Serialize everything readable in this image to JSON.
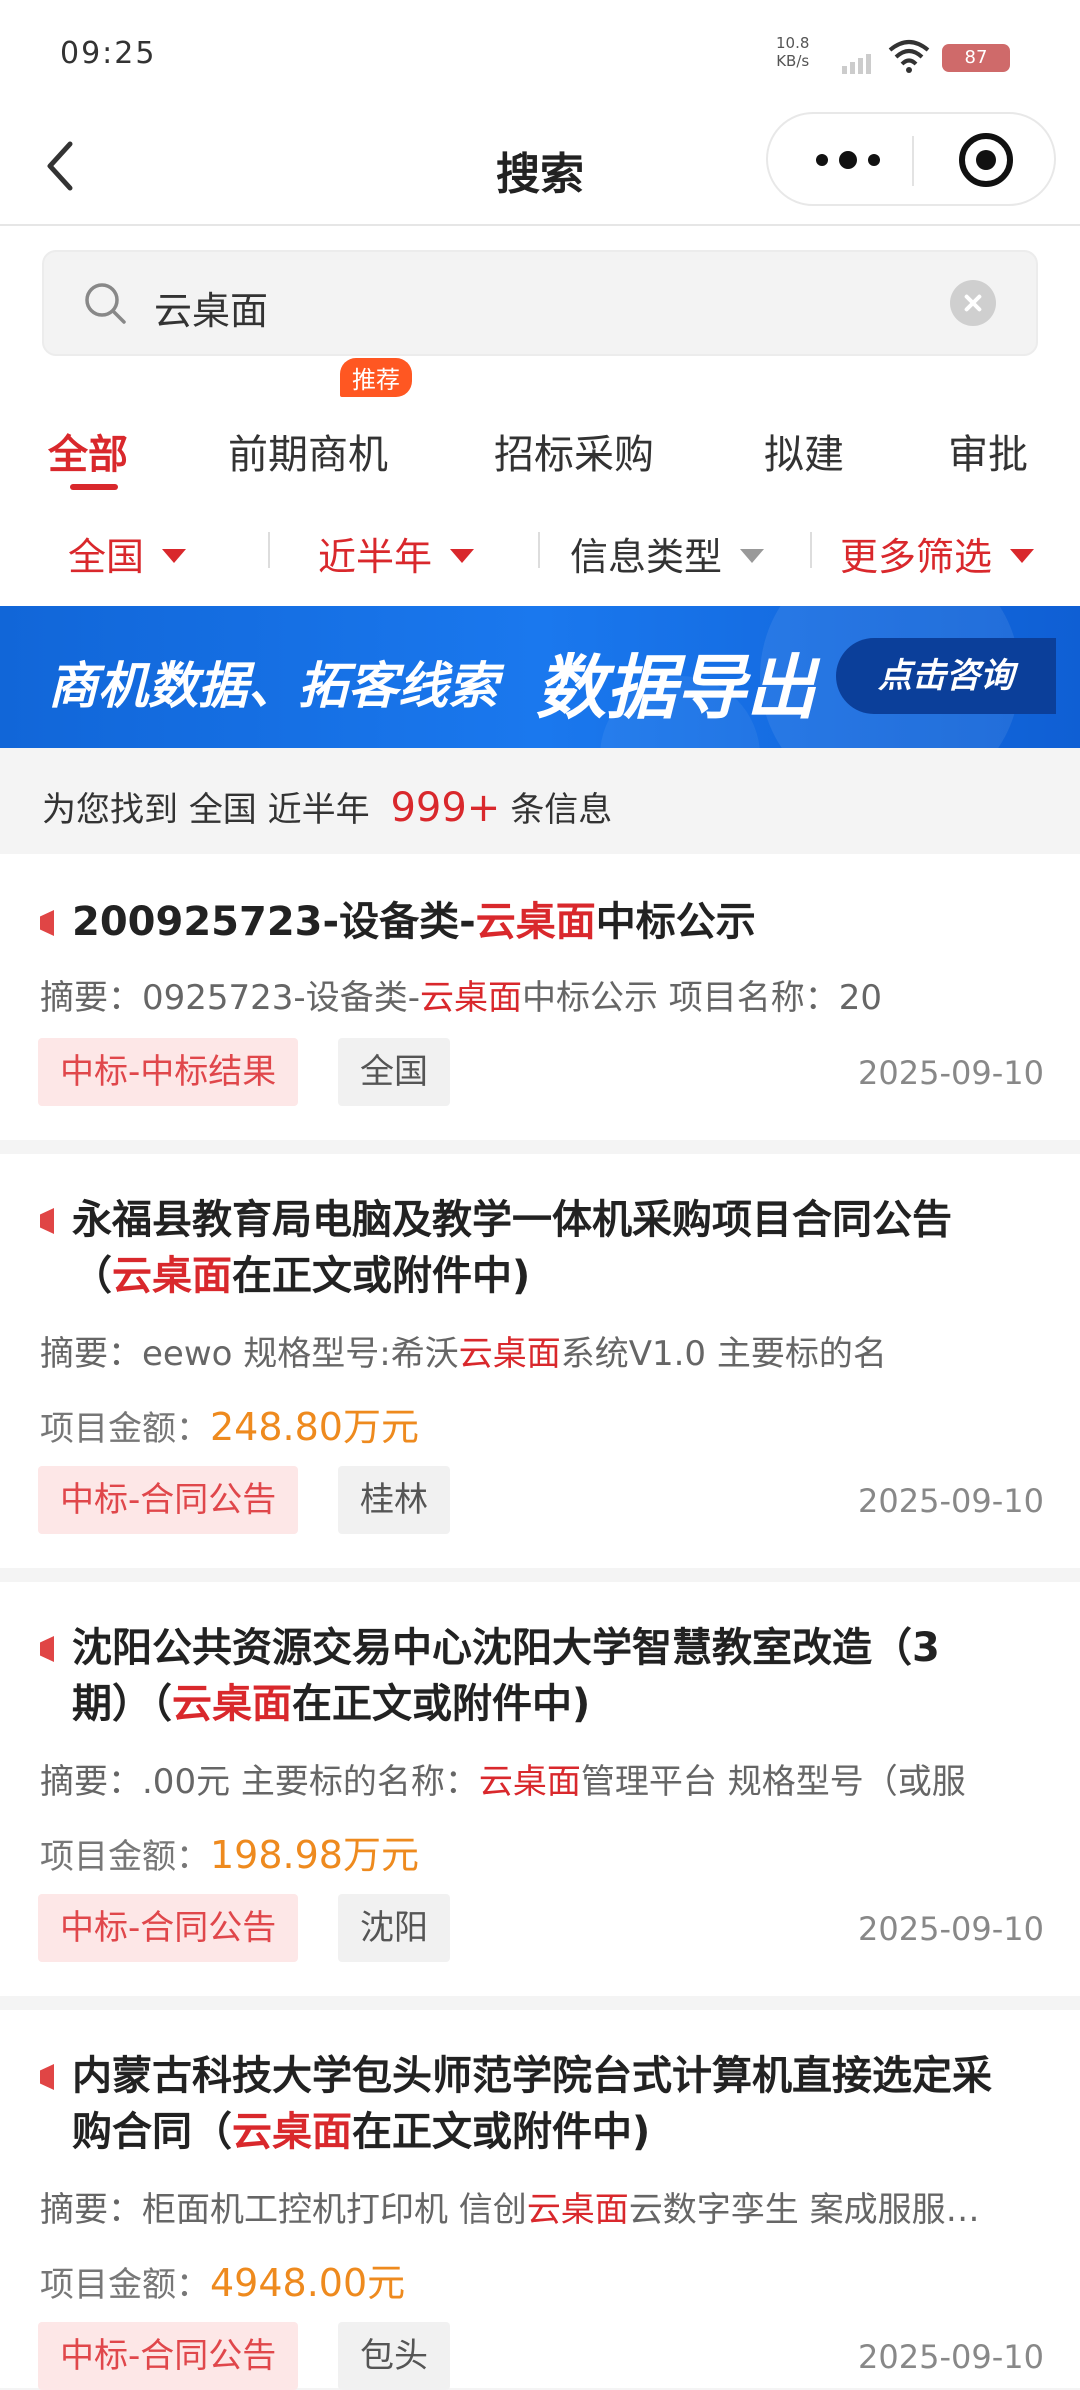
{
  "status": {
    "time": "09:25",
    "speed_top": "10.8",
    "speed_bottom": "KB/s",
    "battery": "87"
  },
  "nav": {
    "title": "搜索"
  },
  "search": {
    "query": "云桌面"
  },
  "tabs": [
    {
      "label": "全部"
    },
    {
      "label": "前期商机"
    },
    {
      "label": "招标采购"
    },
    {
      "label": "拟建"
    },
    {
      "label": "审批"
    }
  ],
  "recommend_badge": "推荐",
  "filters": [
    {
      "label": "全国"
    },
    {
      "label": "近半年"
    },
    {
      "label": "信息类型"
    },
    {
      "label": "更多筛选"
    }
  ],
  "banner": {
    "text_left": "商机数据、拓客线索",
    "text_big": "数据导出",
    "button": "点击咨询"
  },
  "summary": {
    "prefix": "为您找到",
    "region": "全国",
    "period": "近半年",
    "count": "999+",
    "suffix": "条信息"
  },
  "results": [
    {
      "title_pre": "200925723-设备类-",
      "title_hl": "云桌面",
      "title_post": "中标公示",
      "abs_pre": "摘要：0925723-设备类-",
      "abs_hl": "云桌面",
      "abs_post": "中标公示 项目名称：20",
      "amount_label": "",
      "amount_value": "",
      "tag_type": "中标-中标结果",
      "tag_region": "全国",
      "date": "2025-09-10"
    },
    {
      "title_pre": "永福县教育局电脑及教学一体机采购项目合同公告（",
      "title_hl": "云桌面",
      "title_post": "在正文或附件中)",
      "abs_pre": "摘要：eewo 规格型号:希沃",
      "abs_hl": "云桌面",
      "abs_post": "系统V1.0 主要标的名",
      "amount_label": "项目金额：",
      "amount_value": "248.80万元",
      "tag_type": "中标-合同公告",
      "tag_region": "桂林",
      "date": "2025-09-10"
    },
    {
      "title_pre": "沈阳公共资源交易中心沈阳大学智慧教室改造（3期）（",
      "title_hl": "云桌面",
      "title_post": "在正文或附件中)",
      "abs_pre": "摘要：.00元 主要标的名称：",
      "abs_hl": "云桌面",
      "abs_post": "管理平台 规格型号（或服",
      "amount_label": "项目金额：",
      "amount_value": "198.98万元",
      "tag_type": "中标-合同公告",
      "tag_region": "沈阳",
      "date": "2025-09-10"
    },
    {
      "title_pre": "内蒙古科技大学包头师范学院台式计算机直接选定采购合同（",
      "title_hl": "云桌面",
      "title_post": "在正文或附件中)",
      "abs_pre": "摘要：柜面机工控机打印机 信创",
      "abs_hl": "云桌面",
      "abs_post": "云数字孪生 案成服服…",
      "amount_label": "项目金额：",
      "amount_value": "4948.00元",
      "tag_type": "中标-合同公告",
      "tag_region": "包头",
      "date": "2025-09-10"
    }
  ]
}
